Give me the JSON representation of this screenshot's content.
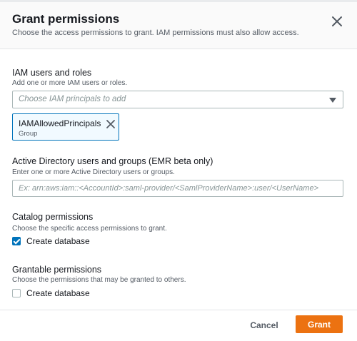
{
  "dialog": {
    "title": "Grant permissions",
    "subtitle": "Choose the access permissions to grant. IAM permissions must also allow access.",
    "close_icon": "close-icon"
  },
  "iam": {
    "label": "IAM users and roles",
    "description": "Add one or more IAM users or roles.",
    "placeholder": "Choose IAM principals to add",
    "token": {
      "name": "IAMAllowedPrincipals",
      "type": "Group"
    }
  },
  "active_directory": {
    "label": "Active Directory users and groups (EMR beta only)",
    "description": "Enter one or more Active Directory users or groups.",
    "placeholder": "Ex: arn:aws:iam::<AccountId>:saml-provider/<SamlProviderName>:user/<UserName>"
  },
  "catalog": {
    "label": "Catalog permissions",
    "description": "Choose the specific access permissions to grant.",
    "options": [
      {
        "label": "Create database",
        "checked": true
      }
    ]
  },
  "grantable": {
    "label": "Grantable permissions",
    "description": "Choose the permissions that may be granted to others.",
    "options": [
      {
        "label": "Create database",
        "checked": false
      }
    ]
  },
  "footer": {
    "cancel_label": "Cancel",
    "grant_label": "Grant"
  },
  "colors": {
    "primary": "#ec7211",
    "accent_blue": "#0073bb",
    "text": "#16191f",
    "muted_text": "#545b64"
  }
}
